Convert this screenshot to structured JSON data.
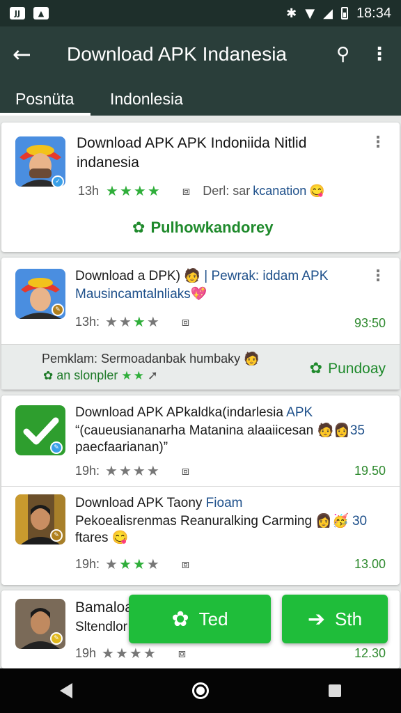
{
  "status_bar": {
    "time": "18:34",
    "notif_a": "JJ",
    "notif_b": "▲",
    "bluetooth": "✱",
    "wifi": "▼",
    "signal": "◢"
  },
  "app_bar": {
    "title": "Download APK Indanesia",
    "back_icon": "arrow-left",
    "search_icon": "search",
    "menu_icon": "more-vert"
  },
  "tabs": [
    {
      "label": "Posnüta",
      "active": true
    },
    {
      "label": "Indonlesia",
      "active": false
    }
  ],
  "items": [
    {
      "title": "Download APK APK Indoniida Nitlid indanesia",
      "time": "13h",
      "rating": 4,
      "rating_max": 4,
      "dev_label": "Derl: sar",
      "dev_link": "kcanation",
      "emoji": "😋",
      "install_label": "Pulhowkandorey"
    },
    {
      "title_a": "Download a DPK)",
      "title_emoji": "🧑",
      "title_b": "| Pewrak: iddam APK",
      "subtitle": "Mausincamtalnliaks",
      "subtitle_emoji": "💖",
      "time": "13h:",
      "rating": 1,
      "rating_max": 4,
      "price": "93:50"
    },
    {
      "title_a": "Download APK  APkaldka(indarlesia",
      "title_b": "APK",
      "line2": "“(caueusiananarha Matanina alaaiicesan",
      "line2_count": "35",
      "line2_emoji": "🧑👩",
      "line3": "paecfaarianan)”",
      "time": "19h:",
      "rating": 0,
      "rating_max": 4,
      "price": "19.50"
    },
    {
      "title_a": "Download APK Taony",
      "title_b": "Fioam",
      "line2": "Pekoealisrenmas Reanuralking Carming",
      "line2_emoji": "👩🥳",
      "line2_count": "30",
      "line3": "ftares",
      "line3_emoji": "😋",
      "time": "19h:",
      "rating": 2,
      "rating_max": 4,
      "price": "13.00"
    },
    {
      "title": "Bamaloa",
      "subtitle": "Sltendlor",
      "time": "19h",
      "rating": 0,
      "rating_max": 4,
      "price": "12.30"
    }
  ],
  "promo": {
    "text": "Pemklam: Sermoadanbak humbaky",
    "text_emoji": "🧑",
    "sub": "an slonpler",
    "action": "Pundoay"
  },
  "fab": {
    "left_label": "Ted",
    "right_label": "Sth"
  },
  "colors": {
    "app_bar": "#2a3e3a",
    "status_bar": "#1e2f2b",
    "accent_green": "#1fbd3a",
    "star_green": "#2fae3a",
    "link_blue": "#1d4f8a"
  }
}
